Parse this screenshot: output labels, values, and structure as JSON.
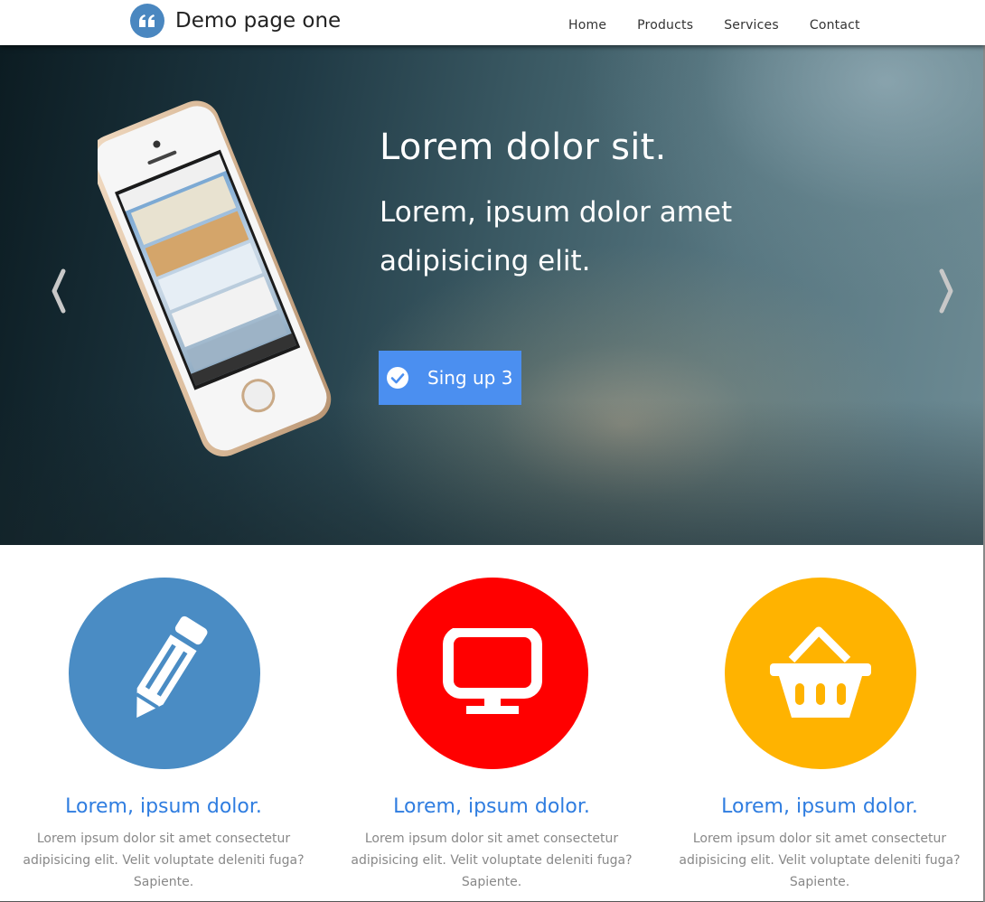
{
  "header": {
    "brand_title": "Demo page one",
    "brand_icon": "quote-icon",
    "nav": [
      {
        "label": "Home"
      },
      {
        "label": "Products"
      },
      {
        "label": "Services"
      },
      {
        "label": "Contact"
      }
    ]
  },
  "hero": {
    "title": "Lorem dolor sit.",
    "subtitle": "Lorem, ipsum dolor amet adipisicing elit.",
    "cta_label": "Sing up 3",
    "cta_icon": "check-circle-icon",
    "prev_icon": "chevron-left-icon",
    "next_icon": "chevron-right-icon",
    "image": "smartphone"
  },
  "features": [
    {
      "icon": "pencil-icon",
      "color": "#4a8cc4",
      "title": "Lorem, ipsum dolor.",
      "text": "Lorem ipsum dolor sit amet consectetur adipisicing elit. Velit voluptate deleniti fuga? Sapiente."
    },
    {
      "icon": "monitor-icon",
      "color": "#ff0000",
      "title": "Lorem, ipsum dolor.",
      "text": "Lorem ipsum dolor sit amet consectetur adipisicing elit. Velit voluptate deleniti fuga? Sapiente."
    },
    {
      "icon": "basket-icon",
      "color": "#ffb300",
      "title": "Lorem, ipsum dolor.",
      "text": "Lorem ipsum dolor sit amet consectetur adipisicing elit. Velit voluptate deleniti fuga? Sapiente."
    }
  ],
  "colors": {
    "accent": "#4b8ff0",
    "feature_title": "#2f7de0"
  }
}
